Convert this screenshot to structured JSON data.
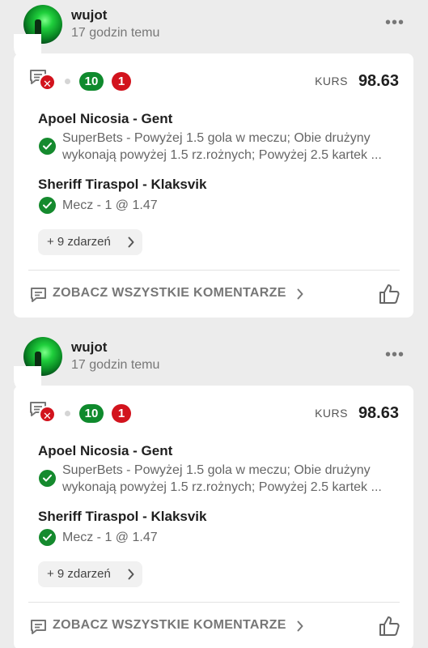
{
  "posts": [
    {
      "username": "wujot",
      "time": "17 godzin temu",
      "menu": "•••",
      "stats": {
        "lost_icon": "✕",
        "won_count": "10",
        "lost_count": "1"
      },
      "kurs_label": "KURS",
      "kurs_value": "98.63",
      "events": [
        {
          "match": "Apoel Nicosia - Gent",
          "bet_line1": "SuperBets - Powyżej 1.5 gola w meczu; Obie drużyny",
          "bet_line2": "wykonają powyżej 1.5 rz.rożnych; Powyżej 2.5 kartek ..."
        },
        {
          "match": "Sheriff Tiraspol - Klaksvik",
          "bet_line1": "Mecz - 1 @ 1.47"
        }
      ],
      "more_events": "+ 9 zdarzeń",
      "comments_label": "ZOBACZ WSZYSTKIE KOMENTARZE"
    },
    {
      "username": "wujot",
      "time": "17 godzin temu",
      "menu": "•••",
      "stats": {
        "lost_icon": "✕",
        "won_count": "10",
        "lost_count": "1"
      },
      "kurs_label": "KURS",
      "kurs_value": "98.63",
      "events": [
        {
          "match": "Apoel Nicosia - Gent",
          "bet_line1": "SuperBets - Powyżej 1.5 gola w meczu; Obie drużyny",
          "bet_line2": "wykonają powyżej 1.5 rz.rożnych; Powyżej 2.5 kartek ..."
        },
        {
          "match": "Sheriff Tiraspol - Klaksvik",
          "bet_line1": "Mecz - 1 @ 1.47"
        }
      ],
      "more_events": "+ 9 zdarzeń",
      "comments_label": "ZOBACZ WSZYSTKIE KOMENTARZE"
    }
  ],
  "colors": {
    "green": "#0f8a2d",
    "red": "#d2131d",
    "background": "#ececec",
    "card": "#ffffff"
  },
  "icons": [
    "chat-icon",
    "check-icon",
    "chevron-right-icon",
    "comment-icon",
    "thumbs-up-icon",
    "more-dots-icon"
  ]
}
